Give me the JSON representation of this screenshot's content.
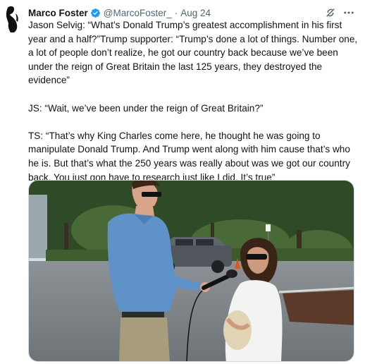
{
  "tweet": {
    "author": {
      "display_name": "Marco Foster",
      "handle": "@MarcoFoster_",
      "verified": true
    },
    "separator": "·",
    "timestamp": "Aug 24",
    "icons": {
      "avatar": "avatar-image",
      "verified": "verified-badge-icon",
      "grok": "grok-icon",
      "more": "more-options-icon"
    },
    "paragraphs": [
      "Jason Selvig: “What’s Donald Trump’s greatest accomplishment in his first year and a half?”Trump supporter: “Trump’s done a lot of things. Number one, a lot of people don’t realize, he got our country back because we’ve been under the reign of Great Britain the last 125 years, they destroyed the evidence”",
      "JS: “Wait, we’ve been under the reign of Great Britain?”",
      "TS: “That’s why King Charles come here, he thought he was going to manipulate Donald Trump. And Trump went along with him cause that’s who he is. But that’s what the 250 years was really about was we got our country back. You just gon have to research just like I did. It’s true”"
    ],
    "media": {
      "type": "photo",
      "subject": "interview-photo"
    }
  },
  "colors": {
    "text": "#0f1419",
    "secondary": "#536471",
    "verified_blue": "#1d9bf0",
    "border": "#cfd9de"
  }
}
